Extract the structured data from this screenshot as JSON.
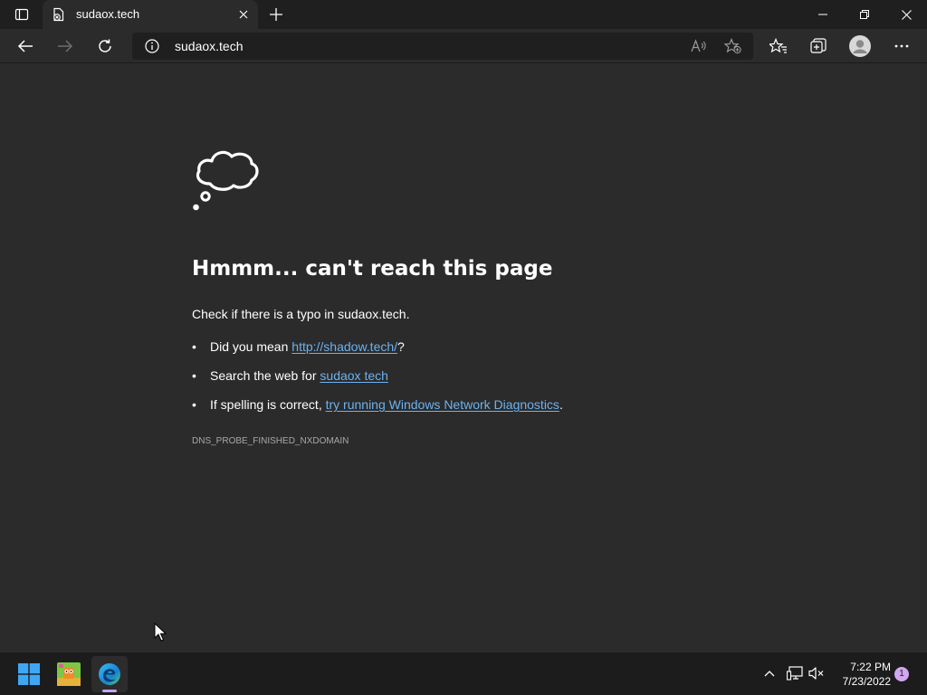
{
  "browser": {
    "tab": {
      "title": "sudaox.tech",
      "favicon": "error-page-icon"
    },
    "address": {
      "url": "sudaox.tech",
      "info_icon": "info-icon"
    },
    "toolbar_icons": [
      "back-icon",
      "forward-icon",
      "refresh-icon",
      "read-aloud-icon",
      "add-favorite-icon",
      "favorites-icon",
      "collections-icon",
      "profile-icon",
      "more-icon"
    ],
    "window_controls": [
      "minimize-icon",
      "restore-icon",
      "close-icon"
    ]
  },
  "page": {
    "icon": "thought-cloud-icon",
    "title": "Hmmm... can't reach this page",
    "check_prefix": "Check if there is a typo in ",
    "check_domain": "sudaox.tech",
    "check_suffix": ".",
    "suggestions": [
      {
        "prefix": "Did you mean ",
        "link": "http://shadow.tech/",
        "suffix": "?"
      },
      {
        "prefix": "Search the web for ",
        "link": "sudaox tech",
        "suffix": ""
      },
      {
        "prefix": "If spelling is correct, ",
        "link": "try running Windows Network Diagnostics",
        "suffix": "."
      }
    ],
    "error_code": "DNS_PROBE_FINISHED_NXDOMAIN"
  },
  "taskbar": {
    "apps": [
      "windows-start-icon",
      "game-app-icon",
      "edge-browser-icon"
    ],
    "tray_icons": [
      "chevron-up-icon",
      "network-icon",
      "volume-muted-icon"
    ],
    "time": "7:22 PM",
    "date": "7/23/2022",
    "notification_count": "1"
  },
  "colors": {
    "background": "#2b2b2b",
    "link": "#6cb2f0",
    "accent_indicator": "#c7a2ff"
  }
}
